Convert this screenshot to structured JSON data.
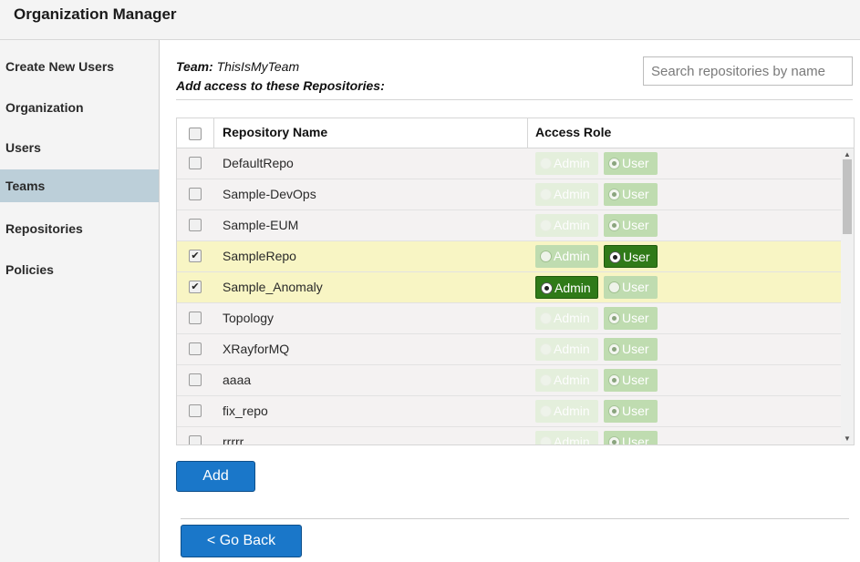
{
  "header": {
    "title": "Organization Manager"
  },
  "sidebar": {
    "items": [
      {
        "label": "Create New Users",
        "active": false
      },
      {
        "label": "Organization",
        "active": false
      },
      {
        "label": "Users",
        "active": false
      },
      {
        "label": "Teams",
        "active": true
      },
      {
        "label": "Repositories",
        "active": false
      },
      {
        "label": "Policies",
        "active": false
      }
    ]
  },
  "main": {
    "team_label": "Team:",
    "team_name": "ThisIsMyTeam",
    "add_access_label": "Add access to these Repositories:",
    "search": {
      "placeholder": "Search repositories by name",
      "value": ""
    },
    "table": {
      "columns": [
        "Repository Name",
        "Access Role"
      ],
      "role_labels": {
        "admin": "Admin",
        "user": "User"
      },
      "rows": [
        {
          "name": "DefaultRepo",
          "checked": false,
          "role": "user"
        },
        {
          "name": "Sample-DevOps",
          "checked": false,
          "role": "user"
        },
        {
          "name": "Sample-EUM",
          "checked": false,
          "role": "user"
        },
        {
          "name": "SampleRepo",
          "checked": true,
          "role": "user"
        },
        {
          "name": "Sample_Anomaly",
          "checked": true,
          "role": "admin"
        },
        {
          "name": "Topology",
          "checked": false,
          "role": "user"
        },
        {
          "name": "XRayforMQ",
          "checked": false,
          "role": "user"
        },
        {
          "name": "aaaa",
          "checked": false,
          "role": "user"
        },
        {
          "name": "fix_repo",
          "checked": false,
          "role": "user"
        },
        {
          "name": "rrrrr",
          "checked": false,
          "role": "user"
        }
      ]
    },
    "add_button": "Add",
    "back_button": "< Go Back"
  },
  "colors": {
    "accent_blue": "#1a77c9",
    "selected_role_green": "#2f7a18",
    "selected_row": "#f8f5c4",
    "active_nav": "#bccfd9"
  }
}
